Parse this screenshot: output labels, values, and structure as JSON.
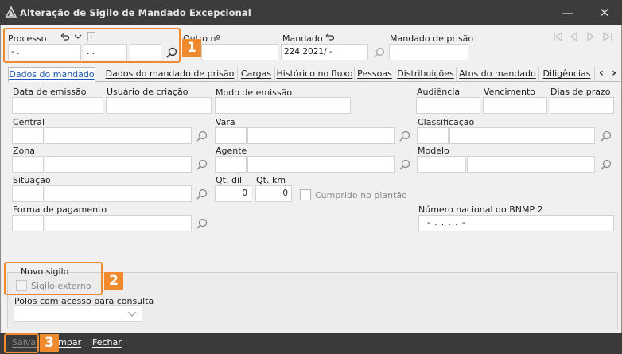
{
  "window": {
    "title": "Alteração de Sigilo de Mandado Excepcional",
    "minimize_icon": "minimize-icon",
    "close_icon": "close-icon"
  },
  "header": {
    "processo_label": "Processo",
    "processo_seg1": "-  .",
    "processo_seg2": ".  .",
    "processo_seg3": "",
    "outro_label": "Outro nº",
    "outro_value": "",
    "mandado_label": "Mandado",
    "mandado_value": "224.2021/     -",
    "mandado_prisao_label": "Mandado de prisão",
    "mandado_prisao_value": ""
  },
  "tabs": [
    {
      "label": "Dados do mandado",
      "active": true
    },
    {
      "label": "Dados do mandado de prisão",
      "active": false
    },
    {
      "label": "Cargas",
      "active": false
    },
    {
      "label": "Histórico no fluxo",
      "active": false
    },
    {
      "label": "Pessoas",
      "active": false
    },
    {
      "label": "Distribuições",
      "active": false
    },
    {
      "label": "Atos do mandado",
      "active": false
    },
    {
      "label": "Diligências",
      "active": false
    }
  ],
  "tab_scroll": {
    "left": "‹",
    "right": "›"
  },
  "form": {
    "data_emissao_label": "Data de emissão",
    "usuario_criacao_label": "Usuário de criação",
    "modo_emissao_label": "Modo de emissão",
    "audiencia_label": "Audiência",
    "vencimento_label": "Vencimento",
    "dias_prazo_label": "Dias de prazo",
    "central_label": "Central",
    "vara_label": "Vara",
    "classificacao_label": "Classificação",
    "zona_label": "Zona",
    "agente_label": "Agente",
    "modelo_label": "Modelo",
    "situacao_label": "Situação",
    "qt_dil_label": "Qt. dil",
    "qt_dil_value": "0",
    "qt_km_label": "Qt. km",
    "qt_km_value": "0",
    "cumprido_label": "Cumprido no plantão",
    "forma_pagamento_label": "Forma de pagamento",
    "bnmp_label": "Número nacional do BNMP 2",
    "bnmp_value": "-   .   .   .   .   -"
  },
  "novo_sigilo": {
    "legend": "Novo sigilo",
    "sigilo_externo_label": "Sigilo externo",
    "polos_label": "Polos com acesso para consulta"
  },
  "footer": {
    "salvar": "Salvar",
    "limpar": "Limpar",
    "fechar": "Fechar"
  },
  "callouts": [
    "1",
    "2",
    "3"
  ],
  "colors": {
    "accent": "#ef8a2e",
    "titlebar": "#3c3c3c",
    "active_tab_text": "#1a58b8"
  }
}
